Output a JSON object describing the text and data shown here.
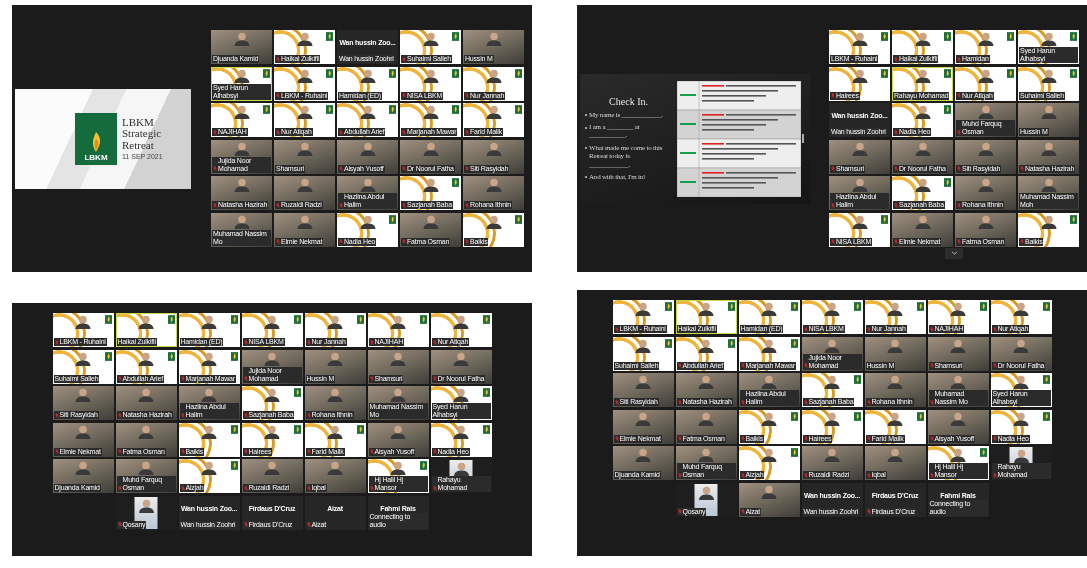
{
  "screens": [
    {
      "kind": "presentation",
      "slide": {
        "kind": "title_slide",
        "logo_text": "LBKM",
        "title": "LBKM Strategic Retreat",
        "date": "11 SEP 2021"
      },
      "rows": [
        [
          {
            "name": "Djuanda Kamid",
            "kind": "camera",
            "muted": false,
            "speaking": false
          },
          {
            "name": "Haikal Zulkifli",
            "kind": "branded",
            "muted": true,
            "speaking": false
          },
          {
            "name": "Wan hussin Zoohri",
            "title": "Wan hussin Zoo...",
            "kind": "name_only",
            "muted": false,
            "speaking": false
          },
          {
            "name": "Suhaimi Salleh",
            "kind": "branded",
            "muted": true,
            "speaking": false
          },
          {
            "name": "Hussin M",
            "kind": "camera",
            "muted": false,
            "speaking": false
          }
        ],
        [
          {
            "name": "Syed Harun Alhabsyi",
            "kind": "branded",
            "muted": false,
            "speaking": true
          },
          {
            "name": "LBKM - Ruhaini",
            "kind": "branded",
            "muted": true,
            "speaking": false
          },
          {
            "name": "Hamidan (ED)",
            "kind": "branded",
            "muted": false,
            "speaking": false
          },
          {
            "name": "NISA LBKM",
            "kind": "branded",
            "muted": true,
            "speaking": false
          },
          {
            "name": "Nur Jannah",
            "kind": "branded",
            "muted": true,
            "speaking": false
          }
        ],
        [
          {
            "name": "NAJIHAH",
            "kind": "branded",
            "muted": true,
            "speaking": false
          },
          {
            "name": "Nur Atiqah",
            "kind": "branded",
            "muted": true,
            "speaking": false
          },
          {
            "name": "Abdullah Arief",
            "kind": "branded",
            "muted": true,
            "speaking": false
          },
          {
            "name": "Marjanah Mawar",
            "kind": "branded",
            "muted": true,
            "speaking": false
          },
          {
            "name": "Farid Malik",
            "kind": "branded",
            "muted": true,
            "speaking": false
          }
        ],
        [
          {
            "name": "Jujida Noor Mohamad",
            "kind": "camera",
            "muted": true,
            "speaking": false
          },
          {
            "name": "Shamsuri",
            "kind": "camera",
            "muted": false,
            "speaking": false
          },
          {
            "name": "Aisyah Yusoff",
            "kind": "camera",
            "muted": true,
            "speaking": false
          },
          {
            "name": "Dr Noorul Fatha",
            "kind": "camera",
            "muted": true,
            "speaking": false
          },
          {
            "name": "Siti Rasyidah",
            "kind": "camera",
            "muted": true,
            "speaking": false
          }
        ],
        [
          {
            "name": "Natasha Hazirah",
            "kind": "camera",
            "muted": true,
            "speaking": false
          },
          {
            "name": "Ruzaidi Radzi",
            "kind": "camera",
            "muted": true,
            "speaking": false
          },
          {
            "name": "Hazlina Abdul Halim",
            "kind": "camera",
            "muted": true,
            "speaking": false
          },
          {
            "name": "Sazjanah Baba",
            "kind": "branded",
            "muted": true,
            "speaking": false
          },
          {
            "name": "Rohana Ithnin",
            "kind": "camera",
            "muted": true,
            "speaking": false
          }
        ],
        [
          {
            "name": "Muhamad Nassim Mo",
            "kind": "camera",
            "muted": false,
            "speaking": false
          },
          {
            "name": "Elmie Nekmat",
            "kind": "camera",
            "muted": true,
            "speaking": false
          },
          {
            "name": "Nadia Heo",
            "kind": "branded",
            "muted": true,
            "speaking": false
          },
          {
            "name": "Fatma Osman",
            "kind": "camera",
            "muted": true,
            "speaking": false
          },
          {
            "name": "Baikis",
            "kind": "branded",
            "muted": true,
            "speaking": false
          }
        ]
      ]
    },
    {
      "kind": "presentation",
      "page_down": true,
      "slide": {
        "kind": "checkin_slide",
        "title": "Check In.",
        "prompts": [
          "My name is ____________.",
          "I am a ________ at ___________.",
          "What made me come to this Retreat today is ____________.",
          "And with that, I'm in!"
        ]
      },
      "rows": [
        [
          {
            "name": "LBKM - Ruhaini",
            "kind": "branded",
            "muted": false,
            "speaking": false
          },
          {
            "name": "Haikal Zulkifli",
            "kind": "branded",
            "muted": true,
            "speaking": false
          },
          {
            "name": "Hamidan",
            "kind": "branded",
            "muted": true,
            "speaking": false
          },
          {
            "name": "Syed Harun Alhabsyi",
            "kind": "branded",
            "muted": false,
            "speaking": false
          }
        ],
        [
          {
            "name": "Hairees",
            "kind": "branded",
            "muted": true,
            "speaking": false
          },
          {
            "name": "Rahayu Mohamad",
            "kind": "branded",
            "muted": false,
            "speaking": true
          },
          {
            "name": "Nur Atiqah",
            "kind": "branded",
            "muted": true,
            "speaking": false
          },
          {
            "name": "Suhaimi Salleh",
            "kind": "branded",
            "muted": false,
            "speaking": false
          }
        ],
        [
          {
            "name": "Wan hussin Zoohri",
            "title": "Wan hussin Zoo...",
            "kind": "name_only",
            "muted": false,
            "speaking": false
          },
          {
            "name": "Nadia Heo",
            "kind": "branded",
            "muted": true,
            "speaking": false
          },
          {
            "name": "Muhd Farquq Osman",
            "kind": "camera",
            "muted": true,
            "speaking": false
          },
          {
            "name": "Hussin M",
            "kind": "camera",
            "muted": false,
            "speaking": false
          }
        ],
        [
          {
            "name": "Shamsuri",
            "kind": "camera",
            "muted": true,
            "speaking": false
          },
          {
            "name": "Dr Noorul Fatha",
            "kind": "camera",
            "muted": true,
            "speaking": false
          },
          {
            "name": "Siti Rasyidah",
            "kind": "camera",
            "muted": true,
            "speaking": false
          },
          {
            "name": "Natasha Hazirah",
            "kind": "camera",
            "muted": true,
            "speaking": false
          }
        ],
        [
          {
            "name": "Hazlina Abdul Halim",
            "kind": "camera",
            "muted": true,
            "speaking": false
          },
          {
            "name": "Sazjanah Baba",
            "kind": "branded",
            "muted": true,
            "speaking": false
          },
          {
            "name": "Rohana Ithnin",
            "kind": "camera",
            "muted": true,
            "speaking": false
          },
          {
            "name": "Muhamad Nassim Moh",
            "kind": "camera",
            "muted": false,
            "speaking": false
          }
        ],
        [
          {
            "name": "NISA LBKM",
            "kind": "branded",
            "muted": true,
            "speaking": false
          },
          {
            "name": "Elmie Nekmat",
            "kind": "camera",
            "muted": true,
            "speaking": false
          },
          {
            "name": "Fatma Osman",
            "kind": "camera",
            "muted": true,
            "speaking": false
          },
          {
            "name": "Baikis",
            "kind": "branded",
            "muted": true,
            "speaking": false
          }
        ]
      ]
    },
    {
      "kind": "gallery",
      "rows": [
        [
          {
            "name": "LBKM - Ruhaini",
            "kind": "branded",
            "muted": true,
            "speaking": false
          },
          {
            "name": "Haikal Zulkifli",
            "kind": "branded",
            "muted": false,
            "speaking": true
          },
          {
            "name": "Hamidan (ED)",
            "kind": "branded",
            "muted": false,
            "speaking": false
          },
          {
            "name": "NISA LBKM",
            "kind": "branded",
            "muted": true,
            "speaking": false
          },
          {
            "name": "Nur Jannah",
            "kind": "branded",
            "muted": true,
            "speaking": false
          },
          {
            "name": "NAJIHAH",
            "kind": "branded",
            "muted": true,
            "speaking": false
          },
          {
            "name": "Nur Atiqah",
            "kind": "branded",
            "muted": true,
            "speaking": false
          }
        ],
        [
          {
            "name": "Suhaimi Salleh",
            "kind": "branded",
            "muted": false,
            "speaking": false
          },
          {
            "name": "Abdullah Arief",
            "kind": "branded",
            "muted": true,
            "speaking": false
          },
          {
            "name": "Marjanah Mawar",
            "kind": "branded",
            "muted": true,
            "speaking": false
          },
          {
            "name": "Jujida Noor Mohamad",
            "kind": "camera",
            "muted": true,
            "speaking": false
          },
          {
            "name": "Hussin M",
            "kind": "camera",
            "muted": false,
            "speaking": false
          },
          {
            "name": "Shamsuri",
            "kind": "camera",
            "muted": true,
            "speaking": false
          },
          {
            "name": "Dr Noorul Fatha",
            "kind": "camera",
            "muted": true,
            "speaking": false
          }
        ],
        [
          {
            "name": "Siti Rasyidah",
            "kind": "camera",
            "muted": true,
            "speaking": false
          },
          {
            "name": "Natasha Hazirah",
            "kind": "camera",
            "muted": true,
            "speaking": false
          },
          {
            "name": "Hazlina Abdul Halim",
            "kind": "camera",
            "muted": true,
            "speaking": false
          },
          {
            "name": "Sazjanah Baba",
            "kind": "branded",
            "muted": true,
            "speaking": false
          },
          {
            "name": "Rohana Ithnin",
            "kind": "camera",
            "muted": true,
            "speaking": false
          },
          {
            "name": "Muhamad Nassim Mo",
            "kind": "camera",
            "muted": false,
            "speaking": false
          },
          {
            "name": "Syed Harun Alhabsyi",
            "kind": "branded",
            "muted": false,
            "speaking": false
          }
        ],
        [
          {
            "name": "Elmie Nekmat",
            "kind": "camera",
            "muted": true,
            "speaking": false
          },
          {
            "name": "Fatma Osman",
            "kind": "camera",
            "muted": true,
            "speaking": false
          },
          {
            "name": "Baikis",
            "kind": "branded",
            "muted": true,
            "speaking": false
          },
          {
            "name": "Hairees",
            "kind": "branded",
            "muted": true,
            "speaking": false
          },
          {
            "name": "Farid Malik",
            "kind": "branded",
            "muted": true,
            "speaking": false
          },
          {
            "name": "Aisyah Yusoff",
            "kind": "camera",
            "muted": true,
            "speaking": false
          },
          {
            "name": "Nadia Heo",
            "kind": "branded",
            "muted": true,
            "speaking": false
          }
        ],
        [
          {
            "name": "Djuanda Kamid",
            "kind": "camera",
            "muted": false,
            "speaking": false
          },
          {
            "name": "Muhd Farquq Osman",
            "kind": "camera",
            "muted": true,
            "speaking": false
          },
          {
            "name": "Aizjah",
            "kind": "branded",
            "muted": true,
            "speaking": false
          },
          {
            "name": "Ruzaidi Radzi",
            "kind": "camera",
            "muted": true,
            "speaking": false
          },
          {
            "name": "Iqbal",
            "kind": "camera",
            "muted": true,
            "speaking": false
          },
          {
            "name": "Hj Halil Hj Mansor",
            "kind": "branded",
            "muted": true,
            "speaking": false
          },
          {
            "name": "Rahayu Mohamad",
            "kind": "portrait",
            "muted": true,
            "speaking": false
          }
        ],
        [
          "",
          {
            "name": "Qosany",
            "kind": "portrait",
            "muted": true,
            "speaking": false
          },
          {
            "name": "Wan hussin Zoohri",
            "title": "Wan hussin Zoo...",
            "kind": "name_only",
            "muted": false,
            "speaking": false
          },
          {
            "name": "Firdaus D'Cruz",
            "title": "Firdaus D'Cruz",
            "kind": "name_only",
            "muted": true,
            "speaking": false
          },
          {
            "name": "Aizat",
            "title": "Aizat",
            "kind": "name_only",
            "muted": true,
            "speaking": false
          },
          {
            "name": "Connecting to audio",
            "title": "Fahmi Rais",
            "kind": "name_only",
            "muted": false,
            "speaking": false
          },
          ""
        ]
      ]
    },
    {
      "kind": "gallery",
      "rows": [
        [
          {
            "name": "LBKM - Ruhaini",
            "kind": "branded",
            "muted": true,
            "speaking": false
          },
          {
            "name": "Haikal Zulkifli",
            "kind": "branded",
            "muted": false,
            "speaking": true
          },
          {
            "name": "Hamidan (ED)",
            "kind": "branded",
            "muted": false,
            "speaking": false
          },
          {
            "name": "NISA LBKM",
            "kind": "branded",
            "muted": true,
            "speaking": false
          },
          {
            "name": "Nur Jannah",
            "kind": "branded",
            "muted": true,
            "speaking": false
          },
          {
            "name": "NAJIHAH",
            "kind": "branded",
            "muted": true,
            "speaking": false
          },
          {
            "name": "Nur Atiqah",
            "kind": "branded",
            "muted": true,
            "speaking": false
          }
        ],
        [
          {
            "name": "Suhaimi Salleh",
            "kind": "branded",
            "muted": false,
            "speaking": false
          },
          {
            "name": "Abdullah Arief",
            "kind": "branded",
            "muted": true,
            "speaking": false
          },
          {
            "name": "Marjanah Mawar",
            "kind": "branded",
            "muted": true,
            "speaking": false
          },
          {
            "name": "Jujida Noor Mohamad",
            "kind": "camera",
            "muted": true,
            "speaking": false
          },
          {
            "name": "Hussin M",
            "kind": "camera",
            "muted": false,
            "speaking": false
          },
          {
            "name": "Shamsuri",
            "kind": "camera",
            "muted": true,
            "speaking": false
          },
          {
            "name": "Dr Noorul Fatha",
            "kind": "camera",
            "muted": true,
            "speaking": false
          }
        ],
        [
          {
            "name": "Siti Rasyidah",
            "kind": "camera",
            "muted": true,
            "speaking": false
          },
          {
            "name": "Natasha Hazirah",
            "kind": "camera",
            "muted": true,
            "speaking": false
          },
          {
            "name": "Hazlina Abdul Halim",
            "kind": "camera",
            "muted": true,
            "speaking": false
          },
          {
            "name": "Sazjanah Baba",
            "kind": "branded",
            "muted": true,
            "speaking": false
          },
          {
            "name": "Rohana Ithnin",
            "kind": "camera",
            "muted": true,
            "speaking": false
          },
          {
            "name": "Muhamad Nassim Mo",
            "kind": "camera",
            "muted": true,
            "speaking": false
          },
          {
            "name": "Syed Harun Alhabsyi",
            "kind": "branded",
            "muted": false,
            "speaking": false
          }
        ],
        [
          {
            "name": "Elmie Nekmat",
            "kind": "camera",
            "muted": true,
            "speaking": false
          },
          {
            "name": "Fatma Osman",
            "kind": "camera",
            "muted": true,
            "speaking": false
          },
          {
            "name": "Baikis",
            "kind": "branded",
            "muted": true,
            "speaking": false
          },
          {
            "name": "Hairees",
            "kind": "branded",
            "muted": true,
            "speaking": false
          },
          {
            "name": "Farid Malik",
            "kind": "branded",
            "muted": true,
            "speaking": false
          },
          {
            "name": "Aisyah Yusoff",
            "kind": "camera",
            "muted": true,
            "speaking": false
          },
          {
            "name": "Nadia Heo",
            "kind": "branded",
            "muted": true,
            "speaking": false
          }
        ],
        [
          {
            "name": "Djuanda Kamid",
            "kind": "camera",
            "muted": false,
            "speaking": false
          },
          {
            "name": "Muhd Farquq Osman",
            "kind": "camera",
            "muted": true,
            "speaking": false
          },
          {
            "name": "Aizjah",
            "kind": "branded",
            "muted": true,
            "speaking": false
          },
          {
            "name": "Ruzaidi Radzi",
            "kind": "camera",
            "muted": true,
            "speaking": false
          },
          {
            "name": "Iqbal",
            "kind": "camera",
            "muted": true,
            "speaking": false
          },
          {
            "name": "Hj Halil Hj Mansor",
            "kind": "branded",
            "muted": true,
            "speaking": false
          },
          {
            "name": "Rahayu Mohamad",
            "kind": "portrait",
            "muted": true,
            "speaking": false
          }
        ],
        [
          "",
          {
            "name": "Qosany",
            "kind": "portrait",
            "muted": true,
            "speaking": false
          },
          {
            "name": "Aizat",
            "kind": "camera",
            "muted": true,
            "speaking": false
          },
          {
            "name": "Wan hussin Zoohri",
            "title": "Wan hussin Zoo...",
            "kind": "name_only",
            "muted": false,
            "speaking": false
          },
          {
            "name": "Firdaus D'Cruz",
            "title": "Firdaus D'Cruz",
            "kind": "name_only",
            "muted": true,
            "speaking": false
          },
          {
            "name": "Connecting to audio",
            "title": "Fahmi Rais",
            "kind": "name_only",
            "muted": false,
            "speaking": false
          },
          ""
        ]
      ]
    }
  ]
}
